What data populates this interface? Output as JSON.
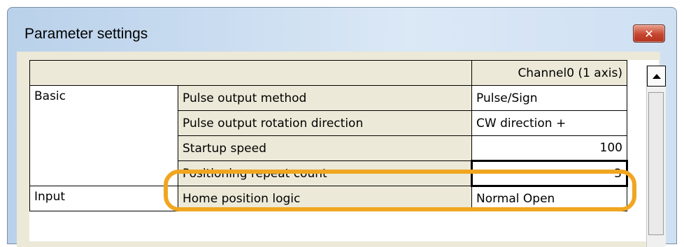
{
  "window": {
    "title": "Parameter settings",
    "close_label": "✕"
  },
  "grid": {
    "column_header": "Channel0 (1 axis)",
    "rows": [
      {
        "category": "Basic",
        "name": "Pulse output method",
        "value": "Pulse/Sign"
      },
      {
        "category": "",
        "name": "Pulse output rotation direction",
        "value": "CW direction +"
      },
      {
        "category": "",
        "name": "Startup speed",
        "value": "100"
      },
      {
        "category": "",
        "name": "Positioning repeat count",
        "value": "3"
      },
      {
        "category": "Input",
        "name": "Home position logic",
        "value": "Normal Open"
      }
    ]
  },
  "highlight_color": "#f0a620"
}
